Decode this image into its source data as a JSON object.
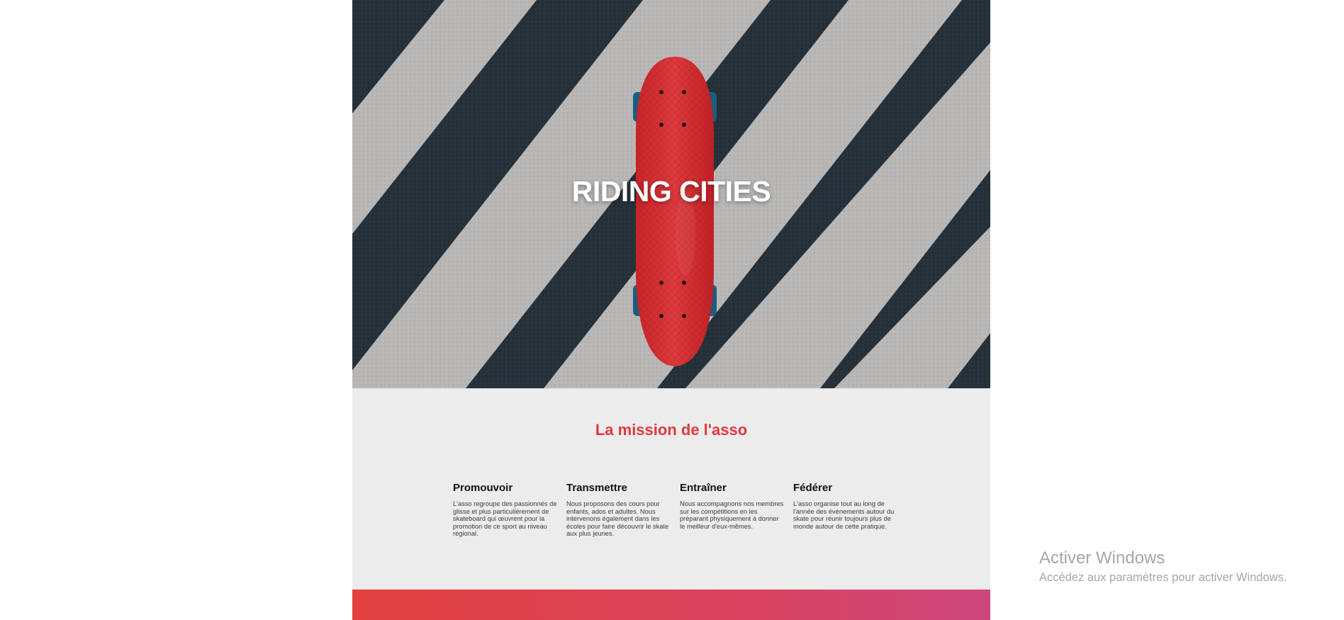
{
  "hero": {
    "title": "RIDING CITIES"
  },
  "mission": {
    "title": "La mission de l'asso",
    "columns": [
      {
        "heading": "Promouvoir",
        "text": "L'asso regroupe des passionnés de glisse et plus particulièrement de skateboard qui œuvrent pour la promotion de ce sport au niveau régional."
      },
      {
        "heading": "Transmettre",
        "text": "Nous proposons des cours pour enfants, ados et adultes. Nous intervenons également dans les écoles pour faire découvrir le skate aux plus jeunes."
      },
      {
        "heading": "Entraîner",
        "text": "Nous accompagnons nos membres sur les compétitions en les préparant physiquement à donner le meilleur d'eux-mêmes."
      },
      {
        "heading": "Fédérer",
        "text": "L'asso organise tout au long de l'année des événements autour du skate pour réunir toujours plus de monde autour de cette pratique."
      }
    ]
  },
  "os_watermark": {
    "title": "Activer Windows",
    "subtitle": "Accédez aux paramètres pour activer Windows."
  },
  "colors": {
    "accent": "#e0393e",
    "gradient_start": "#e2413f",
    "gradient_end": "#cd467c",
    "section_bg": "#ececec"
  },
  "hero_image": {
    "icon": "skateboard-on-striped-asphalt-photo"
  }
}
